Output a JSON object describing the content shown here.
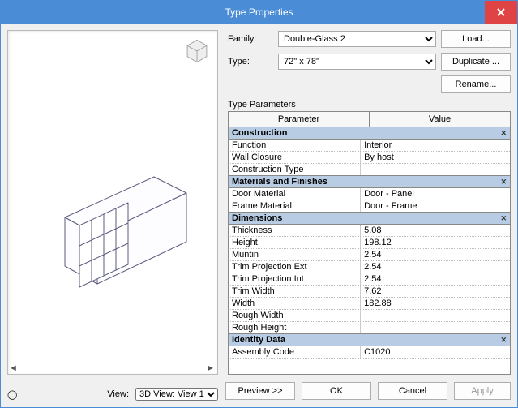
{
  "window": {
    "title": "Type Properties"
  },
  "form": {
    "family_label": "Family:",
    "type_label": "Type:",
    "family_value": "Double-Glass 2",
    "type_value": "72\" x 78\"",
    "load_btn": "Load...",
    "duplicate_btn": "Duplicate ...",
    "rename_btn": "Rename..."
  },
  "params_label": "Type Parameters",
  "grid_header": {
    "param": "Parameter",
    "value": "Value"
  },
  "sections": {
    "construction": {
      "title": "Construction",
      "rows": [
        {
          "param": "Function",
          "value": "Interior"
        },
        {
          "param": "Wall Closure",
          "value": "By host"
        },
        {
          "param": "Construction Type",
          "value": ""
        }
      ]
    },
    "materials": {
      "title": "Materials and Finishes",
      "rows": [
        {
          "param": "Door Material",
          "value": "Door - Panel"
        },
        {
          "param": "Frame Material",
          "value": "Door - Frame"
        }
      ]
    },
    "dimensions": {
      "title": "Dimensions",
      "rows": [
        {
          "param": "Thickness",
          "value": "5.08"
        },
        {
          "param": "Height",
          "value": "198.12"
        },
        {
          "param": "Muntin",
          "value": "2.54"
        },
        {
          "param": "Trim Projection Ext",
          "value": "2.54"
        },
        {
          "param": "Trim Projection Int",
          "value": "2.54"
        },
        {
          "param": "Trim Width",
          "value": "7.62"
        },
        {
          "param": "Width",
          "value": "182.88"
        },
        {
          "param": "Rough Width",
          "value": ""
        },
        {
          "param": "Rough Height",
          "value": ""
        }
      ]
    },
    "identity": {
      "title": "Identity Data",
      "rows": [
        {
          "param": "Assembly Code",
          "value": "C1020"
        }
      ]
    }
  },
  "bottom": {
    "view_label": "View:",
    "view_value": "3D View: View 1",
    "preview_btn": "Preview >>",
    "ok_btn": "OK",
    "cancel_btn": "Cancel",
    "apply_btn": "Apply"
  },
  "icons": {
    "info": "ℹ",
    "collapse": "☆"
  }
}
